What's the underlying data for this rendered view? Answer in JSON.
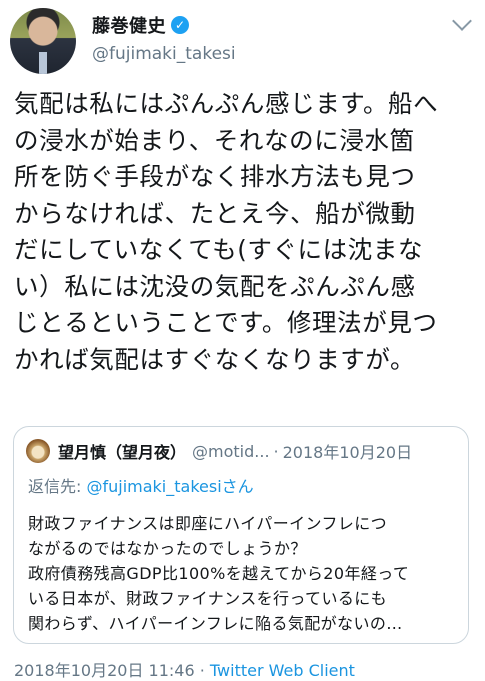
{
  "author": {
    "name": "藤巻健史",
    "handle": "@fujimaki_takesi",
    "verified_icon": "verified-badge-icon"
  },
  "tweet": {
    "lines": [
      "気配は私にはぷんぷん感じます。船へ",
      "の浸水が始まり、それなのに浸水箇",
      "所を防ぐ手段がなく排水方法も見つ",
      "からなければ、たとえ今、船が微動",
      "だにしていなくても(すぐには沈まな",
      "い）私には沈没の気配をぷんぷん感",
      "じとるということです。修理法が見つ",
      "かれば気配はすぐなくなりますが。"
    ]
  },
  "quoted_tweet": {
    "name": "望月慎（望月夜）",
    "handle": "@motid...",
    "separator": "·",
    "date": "2018年10月20日",
    "reply_prefix": "返信先: ",
    "reply_to": "@fujimaki_takesiさん",
    "body_lines": [
      "財政ファイナンスは即座にハイパーインフレにつ",
      "ながるのではなかったのでしょうか？",
      "政府債務残高GDP比100%を越えてから20年経って",
      "いる日本が、財政ファイナンスを行っているにも",
      "関わらず、ハイパーインフレに陥る気配がないの…"
    ]
  },
  "meta": {
    "timestamp": "2018年10月20日 11:46",
    "separator": " · ",
    "client": "Twitter Web Client"
  },
  "colors": {
    "accent": "#1da1f2",
    "link": "#1b95e0",
    "secondary_text": "#657786",
    "border": "#ccd6dd"
  }
}
